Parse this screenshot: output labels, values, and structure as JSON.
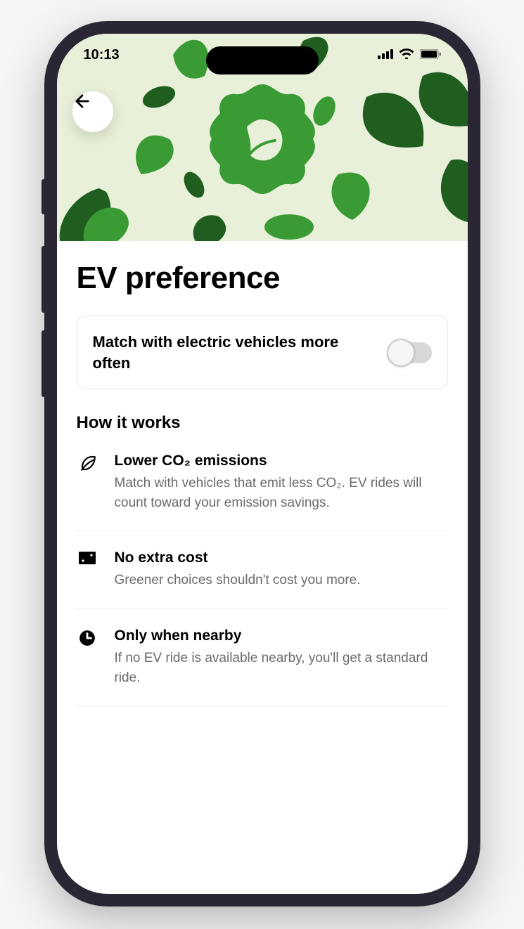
{
  "status": {
    "time": "10:13"
  },
  "page": {
    "title": "EV preference"
  },
  "toggle": {
    "label": "Match with electric vehicles more often",
    "state": "off"
  },
  "how_it_works": {
    "heading": "How it works",
    "items": [
      {
        "icon": "leaf-icon",
        "title": "Lower CO₂ emissions",
        "desc": "Match with vehicles that emit less CO₂. EV rides will count toward your emission savings."
      },
      {
        "icon": "ticket-icon",
        "title": "No extra cost",
        "desc": "Greener choices shouldn't cost you more."
      },
      {
        "icon": "clock-icon",
        "title": "Only when nearby",
        "desc": "If no EV ride is available nearby, you'll get a standard ride."
      }
    ]
  },
  "colors": {
    "accent_green": "#3a9b35",
    "dark_green": "#1f5e1e",
    "hero_bg": "#e8f0d9"
  }
}
